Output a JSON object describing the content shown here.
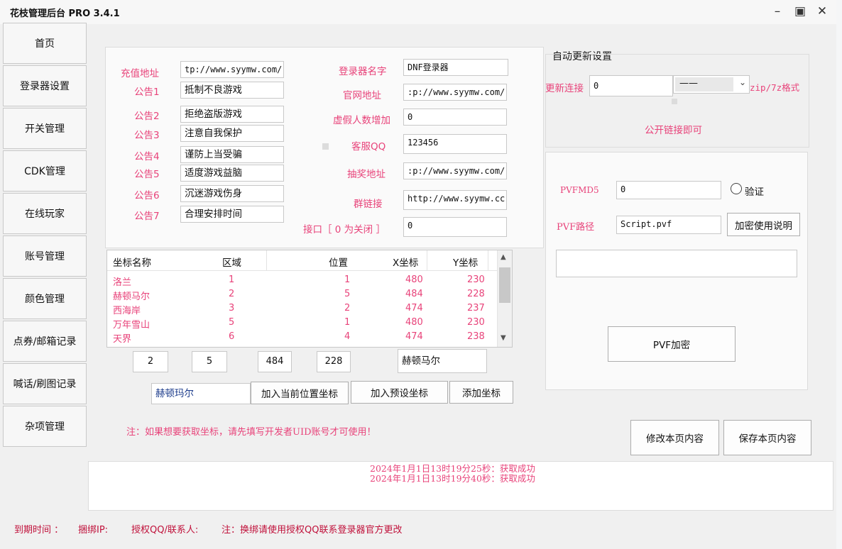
{
  "window": {
    "title": "花枝管理后台 PRO 3.4.1",
    "minimize_glyph": "–",
    "maximize_glyph": "▣",
    "close_glyph": "✕"
  },
  "nav": {
    "items": [
      "首页",
      "登录器设置",
      "开关管理",
      "CDK管理",
      "在线玩家",
      "账号管理",
      "颜色管理",
      "点券/邮箱记录",
      "喊话/刷图记录",
      "杂项管理"
    ]
  },
  "settings": {
    "recharge_label": "充值地址",
    "recharge_value": "tp://www.syymw.com/",
    "notices": [
      {
        "label": "公告1",
        "value": "抵制不良游戏"
      },
      {
        "label": "公告2",
        "value": "拒绝盗版游戏"
      },
      {
        "label": "公告3",
        "value": "注意自我保护"
      },
      {
        "label": "公告4",
        "value": "谨防上当受骗"
      },
      {
        "label": "公告5",
        "value": "适度游戏益脑"
      },
      {
        "label": "公告6",
        "value": "沉迷游戏伤身"
      },
      {
        "label": "公告7",
        "value": "合理安排时间"
      }
    ],
    "launcher_name_label": "登录器名字",
    "launcher_name_value": "DNF登录器",
    "website_label": "官网地址",
    "website_value": ":p://www.syymw.com/",
    "fake_players_label": "虚假人数增加",
    "fake_players_value": "0",
    "service_qq_label": "客服QQ",
    "service_qq_value": "123456",
    "lottery_label": "抽奖地址",
    "lottery_value": ":p://www.syymw.com/",
    "group_link_label": "群链接",
    "group_link_value": "http://www.syymw.cc",
    "port_label": "接口［ 0 为关闭 ］",
    "port_value": "0"
  },
  "auto_update": {
    "legend": "自动更新设置",
    "link_label": "更新连接",
    "link_value": "0",
    "select_value": "——",
    "format_note": "zip/7z格式",
    "hint": "公开链接即可"
  },
  "pvf": {
    "md5_label": "PVFMD5",
    "md5_value": "0",
    "verify_label": "验证",
    "path_label": "PVF路径",
    "path_value": "Script.pvf",
    "help_button": "加密使用说明",
    "encrypt_button": "PVF加密"
  },
  "coords": {
    "columns": [
      "坐标名称",
      "区域",
      "位置",
      "X坐标",
      "Y坐标"
    ],
    "rows": [
      [
        "洛兰",
        "1",
        "1",
        "480",
        "230"
      ],
      [
        "赫顿马尔",
        "2",
        "5",
        "484",
        "228"
      ],
      [
        "西海岸",
        "3",
        "2",
        "474",
        "237"
      ],
      [
        "万年雪山",
        "5",
        "1",
        "480",
        "230"
      ],
      [
        "天界",
        "6",
        "4",
        "474",
        "238"
      ]
    ],
    "edit_area": "2",
    "edit_position": "5",
    "edit_x": "484",
    "edit_y": "228",
    "edit_name": "赫顿马尔",
    "name_input": "赫顿玛尔",
    "add_current_button": "加入当前位置坐标",
    "add_preset_button": "加入预设坐标",
    "add_button": "添加坐标"
  },
  "notice_text": "注：如果想要获取坐标，请先填写开发者UID账号才可使用！",
  "actions": {
    "modify": "修改本页内容",
    "save": "保存本页内容"
  },
  "log": [
    "2024年1月1日13时19分25秒：获取成功",
    "2024年1月1日13时19分40秒：获取成功"
  ],
  "status": {
    "expire": "到期时间 ：",
    "bind_ip": "捆绑IP:",
    "auth_qq": "授权QQ/联系人:",
    "note": "注：换绑请使用授权QQ联系登录器官方更改"
  },
  "colors": {
    "label_pink": "#e8437a",
    "accent_blue": "#1a73e8"
  }
}
